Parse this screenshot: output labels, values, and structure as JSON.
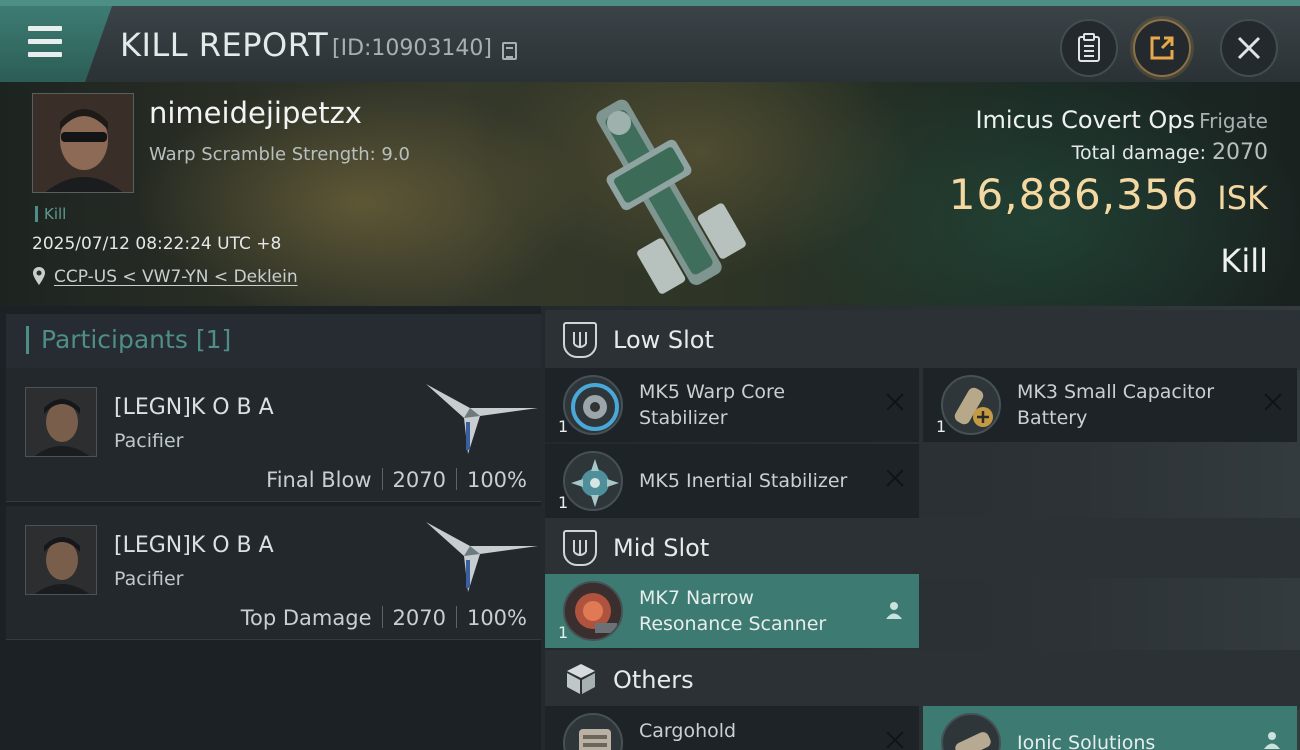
{
  "header": {
    "title": "KILL REPORT",
    "report_id": "[ID:10903140]",
    "icons": [
      "menu-icon",
      "copy-icon",
      "clipboard-icon",
      "share-icon",
      "close-icon"
    ]
  },
  "victim": {
    "name": "nimeidejipetzx",
    "warp_scramble": "Warp Scramble Strength: 9.0",
    "kill_tag": "Kill",
    "datetime": "2025/07/12 08:22:24 UTC +8",
    "location": "CCP-US < VW7-YN < Deklein",
    "ship_name": "Imicus Covert Ops",
    "ship_class": "Frigate",
    "total_damage_label": "Total damage:",
    "total_damage_value": "2070",
    "isk_value": "16,886,356",
    "isk_unit": "ISK",
    "result": "Kill"
  },
  "participants": {
    "title": "Participants",
    "count": "[1]",
    "rows": [
      {
        "name": "[LEGN]K O B A",
        "ship": "Pacifier",
        "role": "Final Blow",
        "damage": "2070",
        "percent": "100%"
      },
      {
        "name": "[LEGN]K O B A",
        "ship": "Pacifier",
        "role": "Top Damage",
        "damage": "2070",
        "percent": "100%"
      }
    ]
  },
  "fitting": {
    "low_slot": {
      "label": "Low Slot",
      "modules": [
        {
          "qty": "1",
          "name_line1": "MK5 Warp Core",
          "name_line2": "Stabilizer",
          "state": "offline"
        },
        {
          "qty": "1",
          "name_line1": "MK3 Small Capacitor",
          "name_line2": "Battery",
          "state": "offline"
        },
        {
          "qty": "1",
          "name_line1": "MK5 Inertial Stabilizer",
          "name_line2": "",
          "state": "offline"
        }
      ]
    },
    "mid_slot": {
      "label": "Mid Slot",
      "modules": [
        {
          "qty": "1",
          "name_line1": "MK7 Narrow",
          "name_line2": "Resonance Scanner",
          "state": "online"
        }
      ]
    },
    "others": {
      "label": "Others",
      "modules": [
        {
          "name_line1": "Cargohold",
          "state": "offline"
        },
        {
          "name_line1": "Ionic Solutions",
          "state": "online"
        }
      ]
    }
  },
  "colors": {
    "accent_teal": "#4d8f84",
    "isk_gold": "#f3d8a2",
    "online_module": "#3d7a71"
  }
}
